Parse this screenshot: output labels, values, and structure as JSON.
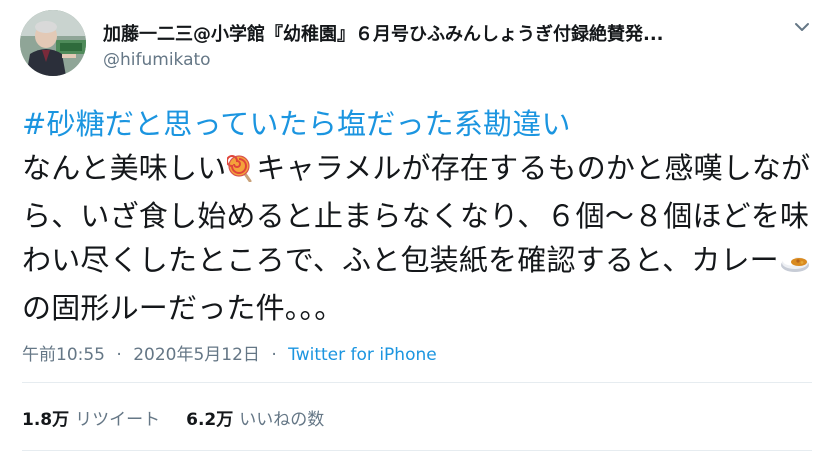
{
  "user": {
    "display_name": "加藤一二三@小学館『幼稚園』６月号ひふみんしょうぎ付録絶賛発...",
    "handle": "@hifumikato"
  },
  "tweet": {
    "hashtag": "#砂糖だと思っていたら塩だった系勘違い",
    "text_1": "なんと美味しい",
    "emoji_1": "lollipop-icon",
    "text_2": "キャラメルが存在するものかと感嘆しながら、いざ食し始めると止まらなくなり、６個〜８個ほどを味わい尽くしたところで、ふと包装紙を確認すると、カレー",
    "emoji_2": "curry-rice-icon",
    "text_3": "の固形ルーだった件。。。"
  },
  "meta": {
    "time": "午前10:55",
    "separator": "·",
    "date": "2020年5月12日",
    "source": "Twitter for iPhone"
  },
  "stats": {
    "retweets_count": "1.8万",
    "retweets_label": "リツイート",
    "likes_count": "6.2万",
    "likes_label": "いいねの数"
  },
  "colors": {
    "link": "#1b95e0",
    "secondary_text": "#657786",
    "divider": "#e6ecf0"
  }
}
